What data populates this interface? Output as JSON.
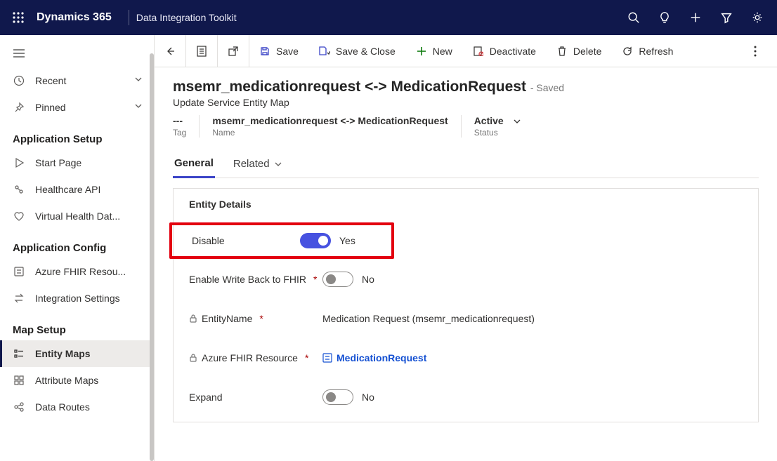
{
  "header": {
    "brand": "Dynamics 365",
    "app_name": "Data Integration Toolkit"
  },
  "sidebar": {
    "recent": "Recent",
    "pinned": "Pinned",
    "groups": {
      "app_setup": "Application Setup",
      "app_config": "Application Config",
      "map_setup": "Map Setup"
    },
    "items": {
      "start_page": "Start Page",
      "healthcare_api": "Healthcare API",
      "virtual_health": "Virtual Health Dat...",
      "azure_fhir": "Azure FHIR Resou...",
      "integration_settings": "Integration Settings",
      "entity_maps": "Entity Maps",
      "attribute_maps": "Attribute Maps",
      "data_routes": "Data Routes"
    }
  },
  "commands": {
    "save": "Save",
    "save_close": "Save & Close",
    "new": "New",
    "deactivate": "Deactivate",
    "delete": "Delete",
    "refresh": "Refresh"
  },
  "record": {
    "title": "msemr_medicationrequest <-> MedicationRequest",
    "saved_suffix": "- Saved",
    "subtitle": "Update Service Entity Map",
    "meta": {
      "tag_value": "---",
      "tag_label": "Tag",
      "name_value": "msemr_medicationrequest <-> MedicationRequest",
      "name_label": "Name",
      "status_value": "Active",
      "status_label": "Status"
    }
  },
  "tabs": {
    "general": "General",
    "related": "Related"
  },
  "form": {
    "section_title": "Entity Details",
    "fields": {
      "disable_label": "Disable",
      "disable_value": "Yes",
      "writeback_label": "Enable Write Back to FHIR",
      "writeback_value": "No",
      "entityname_label": "EntityName",
      "entityname_value": "Medication Request (msemr_medicationrequest)",
      "azurefhir_label": "Azure FHIR Resource",
      "azurefhir_value": "MedicationRequest",
      "expand_label": "Expand",
      "expand_value": "No"
    }
  }
}
